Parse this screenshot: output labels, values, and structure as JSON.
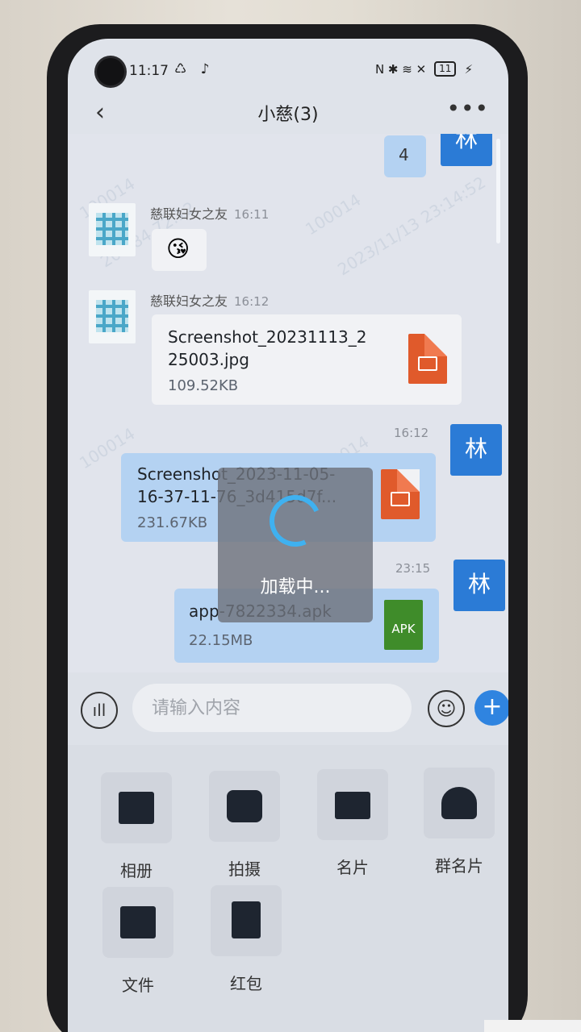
{
  "status_bar": {
    "time": "11:17",
    "left_icons": "♺ ♪",
    "right_icons": "N ✱ ≋ ✕",
    "battery": "11",
    "charging": "⚡"
  },
  "header": {
    "back": "‹",
    "title": "小慈(3)",
    "more": "•••"
  },
  "watermark": [
    "100014",
    "202.84.72.12",
    "2023/11/13 23:14:52"
  ],
  "messages": {
    "self_avatar": "林",
    "m1": {
      "text": "4"
    },
    "m2": {
      "sender": "慈联妇女之友",
      "time": "16:11",
      "emoji": "😘"
    },
    "m3": {
      "sender": "慈联妇女之友",
      "time": "16:12",
      "file_name_l1": "Screenshot_20231113_2",
      "file_name_l2": "25003.jpg",
      "size": "109.52KB"
    },
    "m4": {
      "time": "16:12",
      "file_name_l1": "Screenshot_2023-11-05-",
      "file_name_l2": "16-37-11-76_3d415d7f...",
      "size": "231.67KB"
    },
    "m5": {
      "time": "23:15",
      "file_name": "app-7822334.apk",
      "size": "22.15MB",
      "badge": "APK"
    }
  },
  "loading": {
    "text": "加载中..."
  },
  "input": {
    "placeholder": "请输入内容"
  },
  "tools": [
    {
      "label": "相册",
      "icon": "photo-album-icon"
    },
    {
      "label": "拍摄",
      "icon": "camera-icon"
    },
    {
      "label": "名片",
      "icon": "contact-card-icon"
    },
    {
      "label": "群名片",
      "icon": "group-card-icon"
    },
    {
      "label": "文件",
      "icon": "folder-icon"
    },
    {
      "label": "红包",
      "icon": "red-packet-icon"
    }
  ],
  "colors": {
    "accent": "#2f84e0",
    "self_bubble": "#b4d2f2",
    "spinner": "#3fb1f0"
  }
}
